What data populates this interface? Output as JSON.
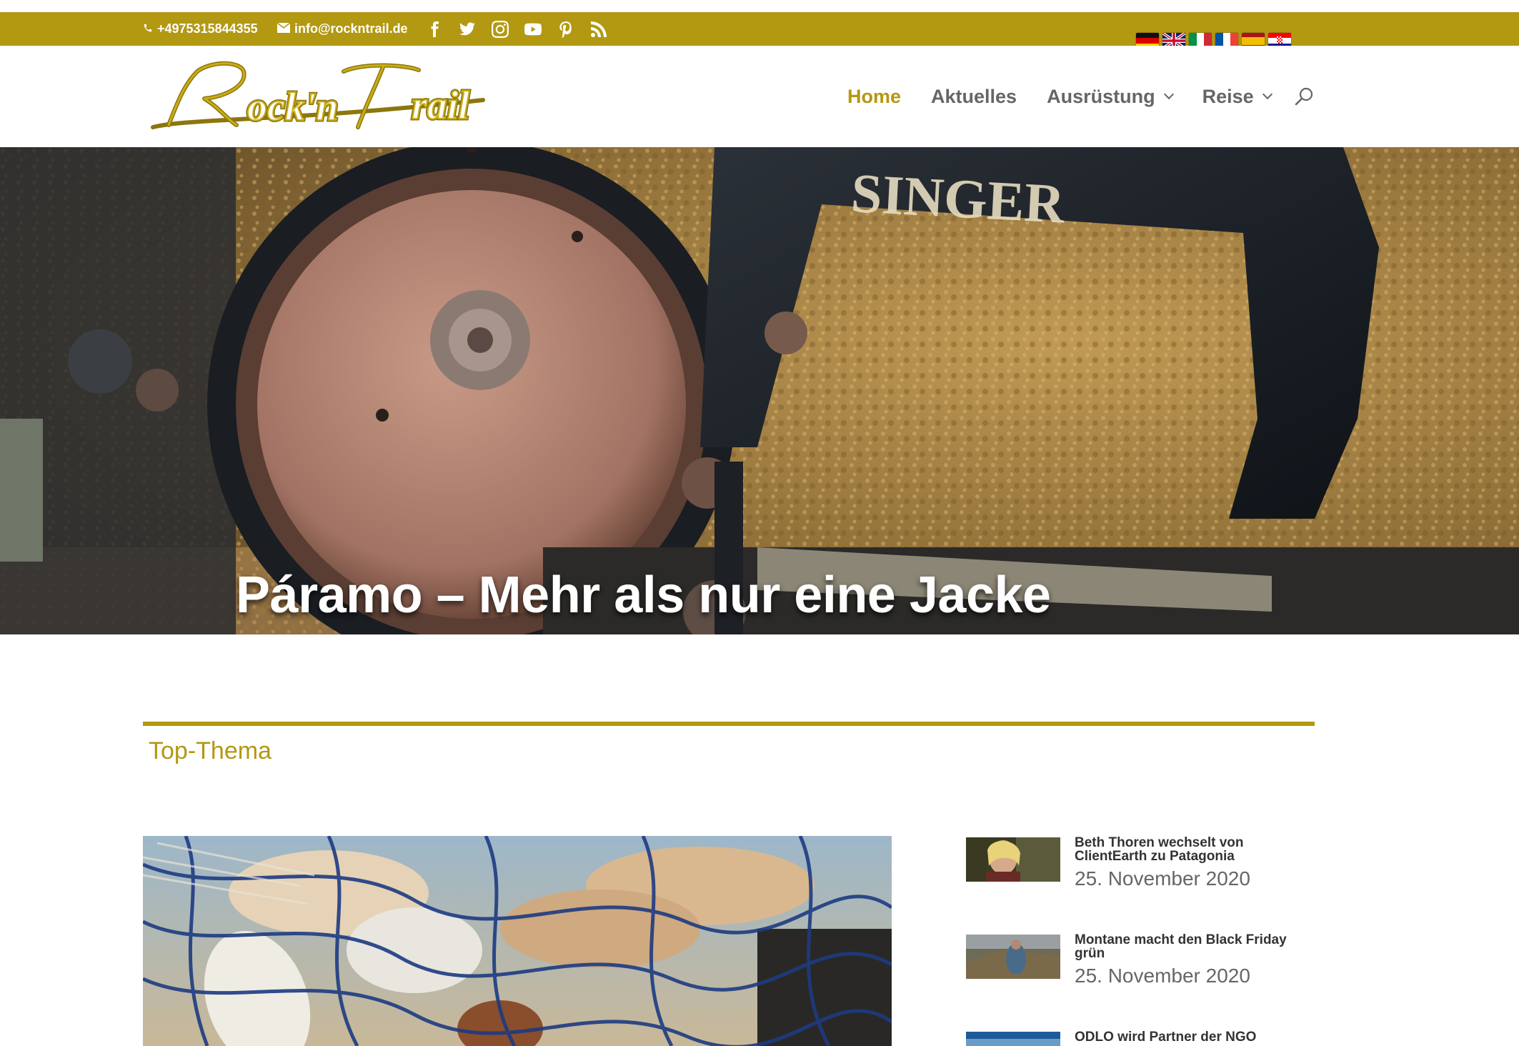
{
  "topbar": {
    "phone": "+4975315844355",
    "email": "info@rockntrail.de",
    "social_icons": [
      "facebook-icon",
      "twitter-icon",
      "instagram-icon",
      "youtube-icon",
      "pinterest-icon",
      "rss-icon"
    ],
    "flags": [
      "de",
      "gb",
      "it",
      "fr",
      "es",
      "hr"
    ]
  },
  "header": {
    "logo_text": "Rock'n Trail",
    "nav": [
      {
        "label": "Home",
        "active": true
      },
      {
        "label": "Aktuelles",
        "active": false
      },
      {
        "label": "Ausrüstung",
        "active": false,
        "has_submenu": true
      },
      {
        "label": "Reise",
        "active": false,
        "has_submenu": true
      }
    ]
  },
  "hero": {
    "title": "Páramo – Mehr als nur eine Jacke",
    "image_text": "SINGER",
    "slides": 4,
    "active_slide": 1
  },
  "section": {
    "title": "Top-Thema"
  },
  "posts": [
    {
      "title": "Beth Thoren wechselt von ClientEarth zu Patagonia",
      "date": "25. November 2020"
    },
    {
      "title": "Montane macht den Black Friday grün",
      "date": "25. November 2020"
    },
    {
      "title": "ODLO wird Partner der NGO",
      "date": ""
    }
  ],
  "colors": {
    "accent": "#b39812",
    "nav_text": "#666666"
  }
}
